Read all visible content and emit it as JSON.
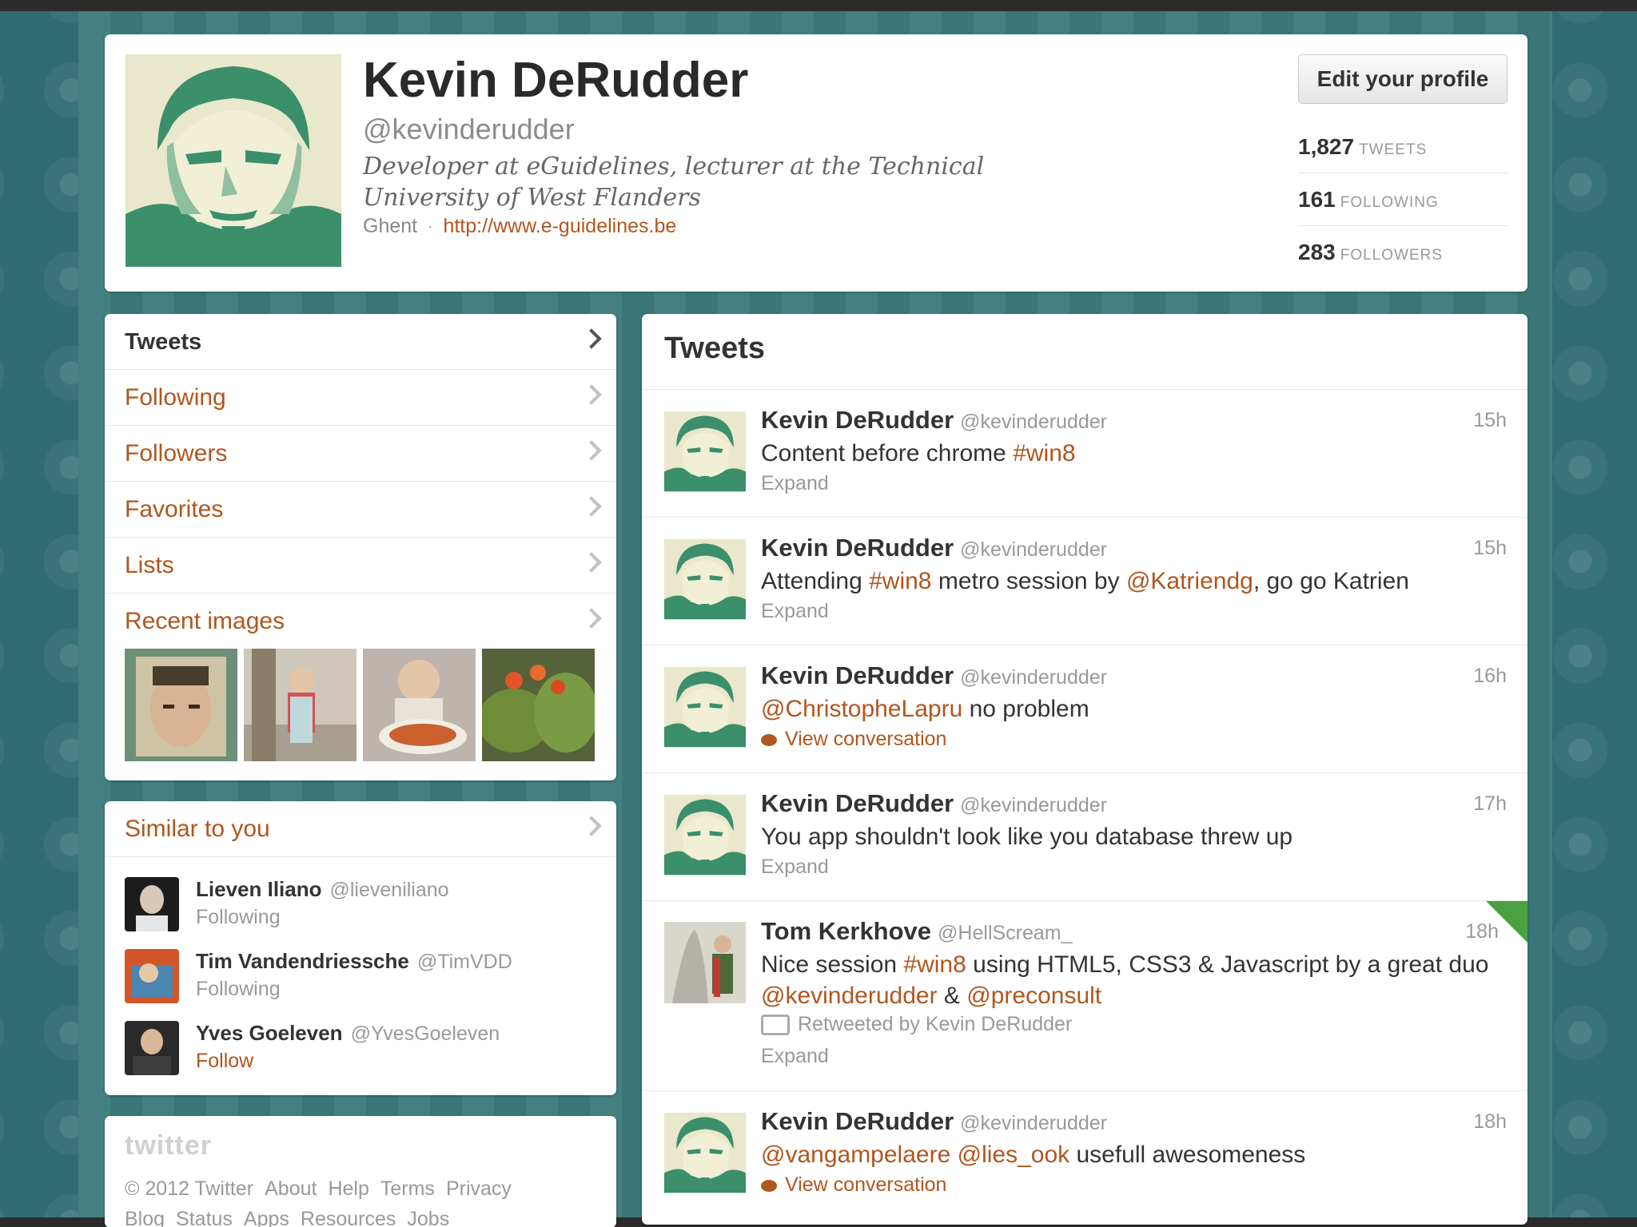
{
  "profile": {
    "name": "Kevin DeRudder",
    "handle": "@kevinderudder",
    "bio": "Developer at eGuidelines, lecturer at the Technical University of West Flanders",
    "location": "Ghent",
    "separator": "·",
    "url": "http://www.e-guidelines.be",
    "edit_button": "Edit your profile",
    "stats": [
      {
        "count": "1,827",
        "label": "TWEETS"
      },
      {
        "count": "161",
        "label": "FOLLOWING"
      },
      {
        "count": "283",
        "label": "FOLLOWERS"
      }
    ]
  },
  "nav": {
    "items": [
      {
        "label": "Tweets"
      },
      {
        "label": "Following"
      },
      {
        "label": "Followers"
      },
      {
        "label": "Favorites"
      },
      {
        "label": "Lists"
      },
      {
        "label": "Recent images"
      }
    ]
  },
  "similar": {
    "title": "Similar to you",
    "people": [
      {
        "name": "Lieven Iliano",
        "handle": "@lieveniliano",
        "status": "Following"
      },
      {
        "name": "Tim Vandendriessche",
        "handle": "@TimVDD",
        "status": "Following"
      },
      {
        "name": "Yves Goeleven",
        "handle": "@YvesGoeleven",
        "status": "Follow"
      }
    ]
  },
  "footer": {
    "logo": "twitter",
    "links_line1": [
      "© 2012 Twitter",
      "About",
      "Help",
      "Terms",
      "Privacy"
    ],
    "links_line2": [
      "Blog",
      "Status",
      "Apps",
      "Resources",
      "Jobs"
    ]
  },
  "timeline": {
    "title": "Tweets",
    "tweets": [
      {
        "name": "Kevin DeRudder",
        "handle": "@kevinderudder",
        "time": "15h",
        "text_before": "Content before chrome ",
        "text_link": "#win8",
        "text_after": "",
        "meta": "Expand"
      },
      {
        "name": "Kevin DeRudder",
        "handle": "@kevinderudder",
        "time": "15h",
        "t1": "Attending ",
        "l1": "#win8",
        "t2": " metro session by ",
        "l2": "@Katriendg",
        "t3": ", go go Katrien",
        "meta": "Expand"
      },
      {
        "name": "Kevin DeRudder",
        "handle": "@kevinderudder",
        "time": "16h",
        "l1": "@ChristopheLapru",
        "t1": " no problem",
        "meta": "View conversation"
      },
      {
        "name": "Kevin DeRudder",
        "handle": "@kevinderudder",
        "time": "17h",
        "t1": "You app shouldn't look like you database threw up",
        "meta": "Expand"
      },
      {
        "name": "Tom Kerkhove",
        "handle": "@HellScream_",
        "time": "18h",
        "t1": "Nice session ",
        "l1": "#win8",
        "t2": " using HTML5, CSS3 & Javascript by a great duo ",
        "l2": "@kevinderudder",
        "t3": " & ",
        "l3": "@preconsult",
        "retweet": "Retweeted by Kevin DeRudder",
        "meta": "Expand"
      },
      {
        "name": "Kevin DeRudder",
        "handle": "@kevinderudder",
        "time": "18h",
        "l1": "@vangampelaere",
        "t1": " ",
        "l2": "@lies_ook",
        "t2": " usefull awesomeness",
        "meta": "View conversation"
      }
    ]
  },
  "colors": {
    "link": "#b0561e",
    "background": "#2f6c72",
    "avatar_green": "#3b8f6b"
  }
}
